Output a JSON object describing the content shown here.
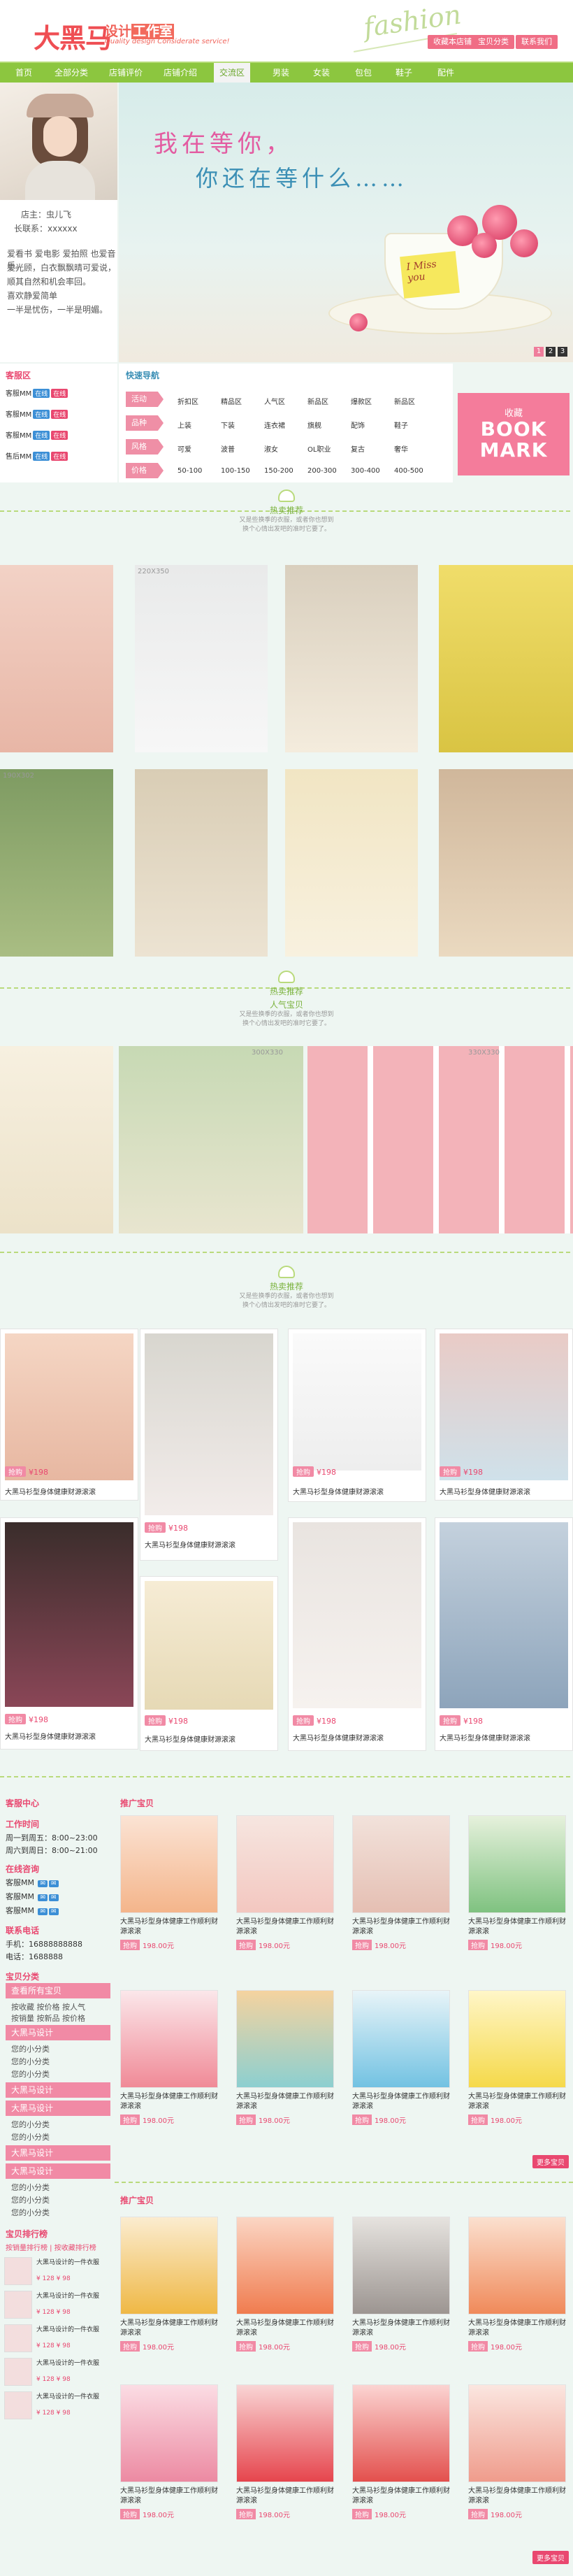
{
  "header": {
    "logo": "大黑马",
    "logo_sub_a": "设计",
    "logo_sub_b": "工作室",
    "tagline": "Quality design  Considerate service!",
    "fashion": "fashion",
    "buttons": [
      "收藏本店铺",
      "宝贝分类",
      "联系我们"
    ]
  },
  "nav": {
    "items": [
      "首页",
      "全部分类",
      "店铺评价",
      "店铺介绍",
      "交流区",
      "男装",
      "女装",
      "包包",
      "鞋子",
      "配件"
    ],
    "active_index": 4
  },
  "profile": {
    "owner_label": "店主：虫儿飞",
    "phone_label": "长联系：xxxxxx",
    "bio": [
      "爱看书 爱电影 爱拍照 也爱音乐。",
      "爱光顾，白衣飘飘晴可爱说，",
      "顺其自然和机会率回。",
      "喜欢静爱简单",
      "一半是忧伤，一半是明媚。"
    ]
  },
  "banner": {
    "line1": "我在等你，",
    "line2": "你还在等什么……",
    "note": "I Miss you",
    "dots": [
      "1",
      "2",
      "3"
    ],
    "active_dot": 0
  },
  "service": {
    "title": "客服区",
    "rows": [
      {
        "name": "客服MM",
        "tags": [
          "在线",
          "在线"
        ]
      },
      {
        "name": "客服MM",
        "tags": [
          "在线",
          "在线"
        ]
      },
      {
        "name": "客服MM",
        "tags": [
          "在线",
          "在线"
        ]
      },
      {
        "name": "售后MM",
        "tags": [
          "在线",
          "在线"
        ]
      }
    ]
  },
  "categories": {
    "title": "快速导航",
    "rows": [
      {
        "label": "活动",
        "items": [
          "折扣区",
          "精品区",
          "人气区",
          "新品区",
          "爆款区",
          "新品区"
        ]
      },
      {
        "label": "品种",
        "items": [
          "上装",
          "下装",
          "连衣裙",
          "旗舰",
          "配饰",
          "鞋子"
        ]
      },
      {
        "label": "风格",
        "items": [
          "可爱",
          "波普",
          "淑女",
          "OL职业",
          "复古",
          "奢华"
        ]
      },
      {
        "label": "价格",
        "items": [
          "50-100",
          "100-150",
          "150-200",
          "200-300",
          "300-400",
          "400-500"
        ]
      }
    ]
  },
  "bookmark": {
    "line1": "收藏",
    "line2": "BOOK",
    "line3": "MARK"
  },
  "sections": [
    {
      "title": "热卖推荐",
      "desc1": "又是些换季的衣服，或者你也想到",
      "desc2": "换个心情出发吧的准时它要了。"
    },
    {
      "title": "热卖推荐",
      "desc1": "又是些换季的衣服，或者你也想到",
      "desc2": "换个心情出发吧的准时它要了。"
    },
    {
      "title": "人气宝贝",
      "desc1": "又是些换季的衣服，或者你也想到",
      "desc2": "换个心情出发吧的准时它要了。"
    },
    {
      "title": "热卖推荐",
      "desc1": "又是些换季的衣服，或者你也想到",
      "desc2": "换个心情出发吧的准时它要了。"
    }
  ],
  "tile_labels": {
    "a": "220X350",
    "b": "190X302",
    "c": "300X330",
    "d": "330X330"
  },
  "cards": {
    "price_label": "¥198",
    "btn": "抢购",
    "desc": "大黑马衫型身体健康财源滚滚"
  },
  "sidebar": {
    "service_title": "客服中心",
    "hours_title": "工作时间",
    "hours": [
      "周一到周五：8:00~23:00",
      "周六到周日：8:00~21:00"
    ],
    "online_title": "在线咨询",
    "online": [
      "客服MM",
      "客服MM",
      "客服MM"
    ],
    "contact_title": "联系电话",
    "contact": [
      "手机：16888888888",
      "电话：1688888"
    ],
    "cat_title": "宝贝分类",
    "cat_first": "查看所有宝贝",
    "cat_sub": [
      "按收藏  按价格  按人气",
      "按销量  按新品  按价格"
    ],
    "groups": [
      "大黑马设计",
      "大黑马设计",
      "大黑马设计",
      "大黑马设计",
      "大黑马设计"
    ],
    "sub_items": [
      "您的小分类",
      "您的小分类",
      "您的小分类"
    ],
    "rank_title": "宝贝排行榜",
    "rank_tabs": [
      "按销量排行榜",
      "按收藏排行榜"
    ],
    "ranks": [
      {
        "t": "大黑马设计的一件衣服",
        "p": "¥ 128  ¥ 98"
      },
      {
        "t": "大黑马设计的一件衣服",
        "p": "¥ 128  ¥ 98"
      },
      {
        "t": "大黑马设计的一件衣服",
        "p": "¥ 128  ¥ 98"
      },
      {
        "t": "大黑马设计的一件衣服",
        "p": "¥ 128  ¥ 98"
      },
      {
        "t": "大黑马设计的一件衣服",
        "p": "¥ 128  ¥ 98"
      }
    ]
  },
  "promo": {
    "title1": "推广宝贝",
    "title2": "推广宝贝",
    "desc": "大黑马衫型身体健康工作顺利财源滚滚",
    "price": "198.00元",
    "btn": "抢购",
    "more": "更多宝贝"
  }
}
